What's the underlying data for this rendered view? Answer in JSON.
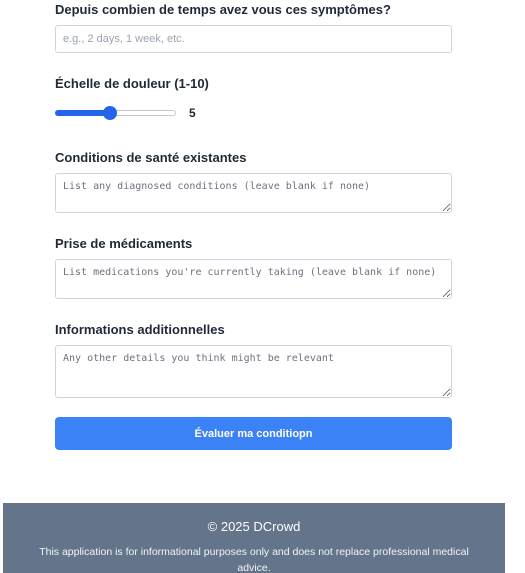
{
  "form": {
    "duration": {
      "label": "Depuis combien de temps avez vous ces symptômes?",
      "placeholder": "e.g., 2 days, 1 week, etc.",
      "value": ""
    },
    "pain_scale": {
      "label": "Échelle de douleur (1-10)",
      "min": 1,
      "max": 10,
      "value": 5,
      "value_text": "5",
      "accent_color": "#2563eb"
    },
    "conditions": {
      "label": "Conditions de santé existantes",
      "placeholder": "List any diagnosed conditions (leave blank if none)",
      "value": ""
    },
    "medications": {
      "label": "Prise de médicaments",
      "placeholder": "List medications you're currently taking (leave blank if none)",
      "value": ""
    },
    "additional": {
      "label": "Informations additionnelles",
      "placeholder": "Any other details you think might be relevant",
      "value": ""
    },
    "submit_label": "Évaluer ma conditiopn",
    "submit_color": "#3b82f6"
  },
  "footer": {
    "copyright": "© 2025 DCrowd",
    "disclaimer": "This application is for informational purposes only and does not replace professional medical advice.",
    "background_color": "#64748b"
  }
}
